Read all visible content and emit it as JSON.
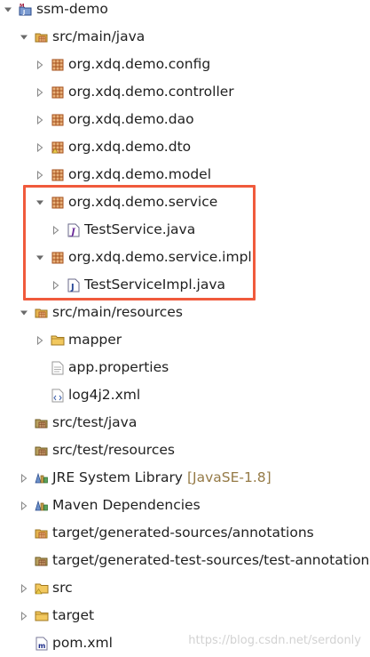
{
  "tree": [
    {
      "label": "ssm-demo",
      "icon": "maven-project-icon",
      "twisty": "open",
      "depth": 0,
      "selected": false
    },
    {
      "label": "src/main/java",
      "icon": "source-folder-icon",
      "twisty": "open",
      "depth": 1
    },
    {
      "label": "org.xdq.demo.config",
      "icon": "package-icon",
      "twisty": "closed",
      "depth": 2
    },
    {
      "label": "org.xdq.demo.controller",
      "icon": "package-icon",
      "twisty": "closed",
      "depth": 2
    },
    {
      "label": "org.xdq.demo.dao",
      "icon": "package-icon",
      "twisty": "closed",
      "depth": 2
    },
    {
      "label": "org.xdq.demo.dto",
      "icon": "package-icon-warning",
      "twisty": "closed",
      "depth": 2
    },
    {
      "label": "org.xdq.demo.model",
      "icon": "package-icon",
      "twisty": "closed",
      "depth": 2
    },
    {
      "label": "org.xdq.demo.service",
      "icon": "package-icon",
      "twisty": "open",
      "depth": 2
    },
    {
      "label": "TestService.java",
      "icon": "java-interface-file-icon",
      "twisty": "closed",
      "depth": 3
    },
    {
      "label": "org.xdq.demo.service.impl",
      "icon": "package-icon",
      "twisty": "open",
      "depth": 2
    },
    {
      "label": "TestServiceImpl.java",
      "icon": "java-class-file-icon",
      "twisty": "closed",
      "depth": 3
    },
    {
      "label": "src/main/resources",
      "icon": "source-folder-icon",
      "twisty": "open",
      "depth": 1
    },
    {
      "label": "mapper",
      "icon": "folder-icon",
      "twisty": "closed",
      "depth": 2
    },
    {
      "label": "app.properties",
      "icon": "properties-file-icon",
      "twisty": "none",
      "depth": 2
    },
    {
      "label": "log4j2.xml",
      "icon": "xml-file-icon",
      "twisty": "none",
      "depth": 2
    },
    {
      "label": "src/test/java",
      "icon": "source-folder-icon-empty",
      "twisty": "none",
      "depth": 1
    },
    {
      "label": "src/test/resources",
      "icon": "source-folder-icon-empty",
      "twisty": "none",
      "depth": 1
    },
    {
      "label": "JRE System Library",
      "decoration": "[JavaSE-1.8]",
      "icon": "library-icon",
      "twisty": "closed",
      "depth": 1
    },
    {
      "label": "Maven Dependencies",
      "icon": "library-icon",
      "twisty": "closed",
      "depth": 1
    },
    {
      "label": "target/generated-sources/annotations",
      "icon": "source-folder-icon",
      "twisty": "none",
      "depth": 1
    },
    {
      "label": "target/generated-test-sources/test-annotations",
      "icon": "source-folder-icon-empty",
      "twisty": "none",
      "depth": 1
    },
    {
      "label": "src",
      "icon": "folder-icon-warning",
      "twisty": "closed",
      "depth": 1
    },
    {
      "label": "target",
      "icon": "folder-icon",
      "twisty": "closed",
      "depth": 1
    },
    {
      "label": "pom.xml",
      "icon": "maven-pom-icon",
      "twisty": "none",
      "depth": 1
    }
  ],
  "watermark": "https://blog.csdn.net/serdonly",
  "colors": {
    "highlight_border": "#f05a3c",
    "decoration_text": "#957a46",
    "package_icon": "#a4501e",
    "folder_icon": "#e6b450"
  }
}
